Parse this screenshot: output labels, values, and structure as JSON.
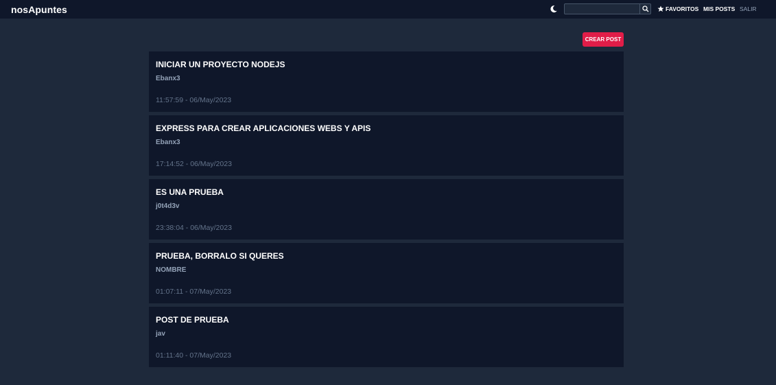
{
  "app": {
    "brand": "nosApuntes"
  },
  "header": {
    "theme_icon": "moon-icon",
    "search_value": "",
    "search_icon": "search-icon",
    "nav": {
      "favoritos": "FAVORITOS",
      "favoritos_icon": "star-icon",
      "mis_posts": "MIS POSTS",
      "salir": "SALIR"
    }
  },
  "actions": {
    "create_post": "CREAR POST"
  },
  "posts": [
    {
      "title": "INICIAR UN PROYECTO NODEJS",
      "author": "Ebanx3",
      "date": "11:57:59 - 06/May/2023"
    },
    {
      "title": "EXPRESS PARA CREAR APLICACIONES WEBS Y APIS",
      "author": "Ebanx3",
      "date": "17:14:52 - 06/May/2023"
    },
    {
      "title": "ES UNA PRUEBA",
      "author": "j0t4d3v",
      "date": "23:38:04 - 06/May/2023"
    },
    {
      "title": "PRUEBA, BORRALO SI QUERES",
      "author": "NOMBRE",
      "date": "01:07:11 - 07/May/2023"
    },
    {
      "title": "POST DE PRUEBA",
      "author": "jav",
      "date": "01:11:40 - 07/May/2023"
    }
  ],
  "colors": {
    "background": "#1e293b",
    "topbar": "#0f172a",
    "card": "#0f172a",
    "accent": "#e11d48"
  }
}
